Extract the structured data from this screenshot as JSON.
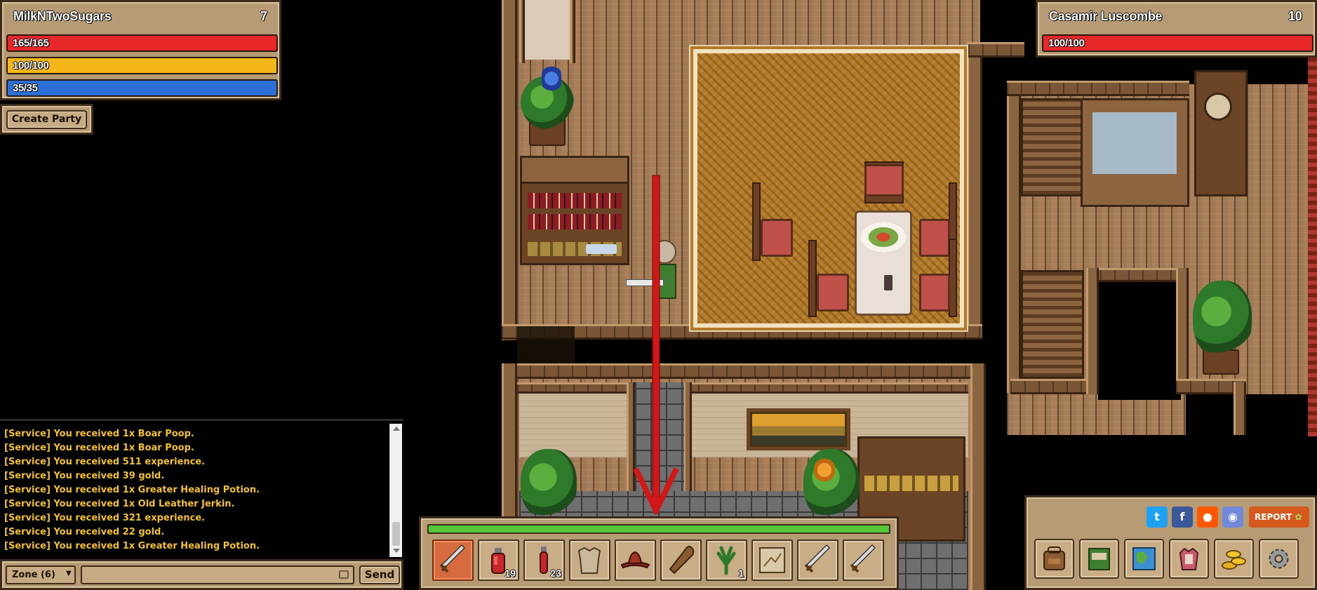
{
  "player": {
    "name": "MilkNTwoSugars",
    "level": "7",
    "health_text": "165/165",
    "health_fraction": 1.0,
    "energy_text": "100/100",
    "energy_fraction": 1.0,
    "mana_text": "35/35",
    "mana_fraction": 1.0
  },
  "party": {
    "create_label": "Create Party"
  },
  "target": {
    "name": "Casamir Luscombe",
    "level": "10",
    "health_text": "100/100",
    "health_fraction": 1.0
  },
  "chat": {
    "lines": [
      "[Service] You received 1x Boar Poop.",
      "[Service] You received 1x Boar Poop.",
      "[Service] You received 511 experience.",
      "[Service] You received 39 gold.",
      "[Service] You received 1x Greater Healing Potion.",
      "[Service] You received 1x Old Leather Jerkin.",
      "[Service] You received 321 experience.",
      "[Service] You received 22 gold.",
      "[Service] You received 1x Greater Healing Potion."
    ],
    "channel": "Zone (6)",
    "input_value": "",
    "send_label": "Send"
  },
  "hotbar": {
    "experience_fraction": 1.0,
    "slots": [
      {
        "icon": "sword-icon",
        "count": ""
      },
      {
        "icon": "red-potion-icon",
        "count": "19"
      },
      {
        "icon": "red-vial-icon",
        "count": "23"
      },
      {
        "icon": "leather-armor-icon",
        "count": ""
      },
      {
        "icon": "hat-icon",
        "count": ""
      },
      {
        "icon": "club-icon",
        "count": ""
      },
      {
        "icon": "herb-icon",
        "count": "1"
      },
      {
        "icon": "map-scroll-icon",
        "count": ""
      },
      {
        "icon": "sword-icon",
        "count": ""
      },
      {
        "icon": "sword-icon",
        "count": ""
      }
    ]
  },
  "menu": {
    "report_label": "REPORT",
    "social": [
      "twitter-icon",
      "facebook-icon",
      "reddit-icon",
      "discord-icon"
    ],
    "buttons": [
      "backpack-icon",
      "spellbook-icon",
      "world-map-icon",
      "character-icon",
      "gold-icon",
      "settings-icon"
    ]
  },
  "colors": {
    "health": "#e8272a",
    "energy": "#f4b619",
    "mana": "#2d6fd8",
    "experience": "#55c83a",
    "chat_text": "#f3c02e",
    "panel": "#b79b75",
    "arrow": "#d11717"
  }
}
